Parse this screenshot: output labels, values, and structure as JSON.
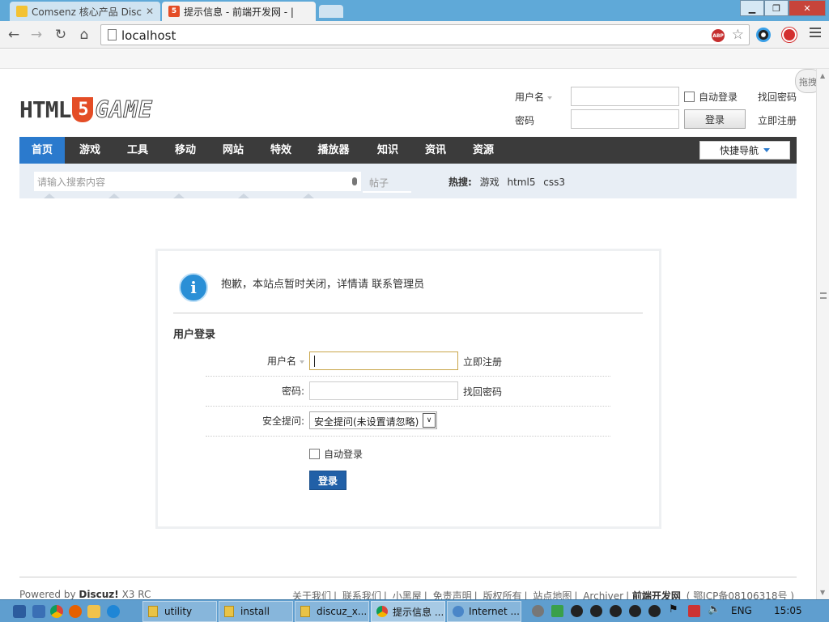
{
  "browser": {
    "tabs": [
      {
        "title": "Comsenz 核心产品 Discu",
        "active": false
      },
      {
        "title": "提示信息 - 前端开发网 - |",
        "active": true
      }
    ],
    "url": "localhost",
    "abp_label": "ABP"
  },
  "drag_handle": {
    "label": "拖拽"
  },
  "logo": {
    "html": "HTML",
    "five": "5",
    "game": "GAME"
  },
  "top_login": {
    "username_label": "用户名",
    "password_label": "密码",
    "auto_login_label": "自动登录",
    "forgot_label": "找回密码",
    "register_label": "立即注册",
    "login_button": "登录"
  },
  "nav": {
    "items": [
      "首页",
      "游戏",
      "工具",
      "移动",
      "网站",
      "特效",
      "播放器",
      "知识",
      "资讯",
      "资源"
    ],
    "active_index": 0,
    "quick_nav": "快捷导航"
  },
  "search": {
    "placeholder": "请输入搜索内容",
    "type": "帖子",
    "hot_label": "热搜:",
    "hot_terms": [
      "游戏",
      "html5",
      "css3"
    ]
  },
  "message": {
    "text": "抱歉，本站点暂时关闭，详情请",
    "link": "联系管理员"
  },
  "login_form": {
    "title": "用户登录",
    "username_label": "用户名",
    "register_link": "立即注册",
    "password_label": "密码:",
    "forgot_link": "找回密码",
    "question_label": "安全提问:",
    "question_value": "安全提问(未设置请忽略)",
    "auto_login_label": "自动登录",
    "submit_label": "登录"
  },
  "footer": {
    "powered_prefix": "Powered by",
    "powered_name": "Discuz!",
    "powered_version": "X3 RC",
    "links": [
      "关于我们",
      "联系我们",
      "小黑屋",
      "免责声明",
      "版权所有",
      "站点地图",
      "Archiver"
    ],
    "site_name": "前端开发网",
    "icp": "( 鄂ICP备08106318号 )"
  },
  "taskbar": {
    "items": [
      "utility",
      "install",
      "discuz_x...",
      "提示信息 ...",
      "Internet ..."
    ],
    "lang": "ENG",
    "time": "15:05"
  },
  "colors": {
    "nav_bg": "#3b3b3b",
    "nav_active": "#2b7acd",
    "submit_button": "#2160a7",
    "taskbar": "#5f9ecf"
  }
}
